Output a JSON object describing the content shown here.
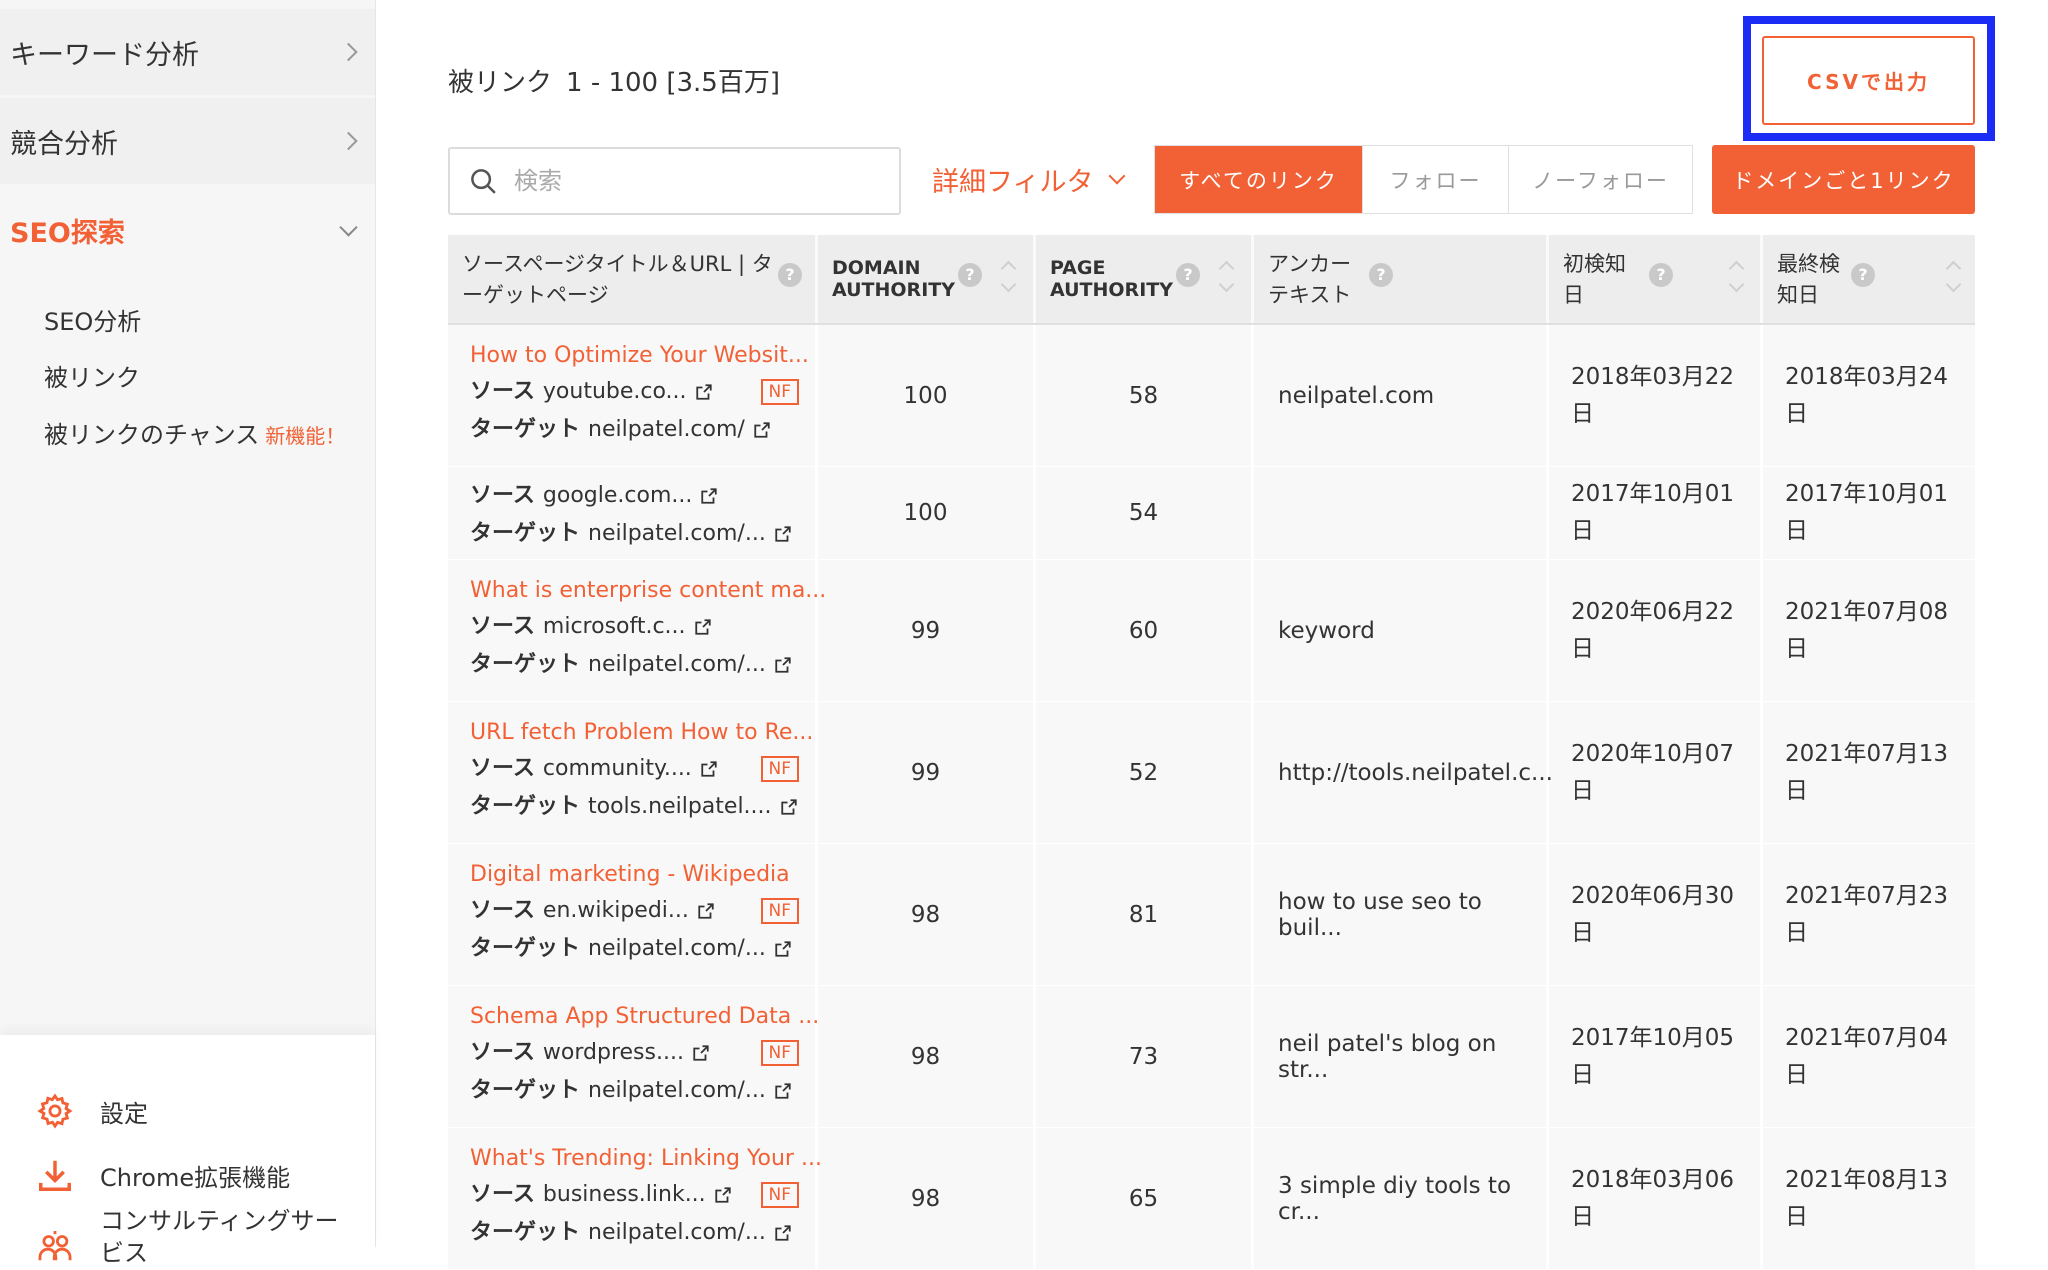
{
  "sidebar": {
    "menu": [
      {
        "label": "キーワード分析"
      },
      {
        "label": "競合分析"
      },
      {
        "label": "SEO探索"
      }
    ],
    "submenu": [
      {
        "label": "SEO分析"
      },
      {
        "label": "被リンク"
      },
      {
        "label": "被リンクのチャンス",
        "badge": "新機能！"
      }
    ],
    "bottom": [
      {
        "label": "設定",
        "icon": "gear-icon"
      },
      {
        "label": "Chrome拡張機能",
        "icon": "download-icon"
      },
      {
        "label": "コンサルティングサービス",
        "icon": "people-icon"
      }
    ]
  },
  "header": {
    "title": "被リンク",
    "range": "1 - 100 [3.5百万]",
    "csv_button": "CSVで出力"
  },
  "toolbar": {
    "search_placeholder": "検索",
    "filter_label": "詳細フィルタ",
    "tabs": [
      "すべてのリンク",
      "フォロー",
      "ノーフォロー"
    ],
    "domain_button": "ドメインごと1リンク"
  },
  "table": {
    "headers": {
      "source": "ソースページタイトル＆URL | ターゲットページ",
      "domain_authority": "DOMAIN AUTHORITY",
      "page_authority": "PAGE AUTHORITY",
      "anchor": "アンカーテキスト",
      "first_seen": "初検知日",
      "last_seen": "最終検知日"
    },
    "source_label": "ソース",
    "target_label": "ターゲット",
    "nf_label": "NF",
    "rows": [
      {
        "title": "How to Optimize Your Websit...",
        "source": "youtube.co...",
        "target": "neilpatel.com/",
        "nf": true,
        "da": "100",
        "pa": "58",
        "anchor": "neilpatel.com",
        "first": "2018年03月22日",
        "last": "2018年03月24日"
      },
      {
        "title": "",
        "source": "google.com...",
        "target": "neilpatel.com/...",
        "nf": false,
        "da": "100",
        "pa": "54",
        "anchor": "",
        "first": "2017年10月01日",
        "last": "2017年10月01日"
      },
      {
        "title": "What is enterprise content ma...",
        "source": "microsoft.c...",
        "target": "neilpatel.com/...",
        "nf": false,
        "da": "99",
        "pa": "60",
        "anchor": "keyword",
        "first": "2020年06月22日",
        "last": "2021年07月08日"
      },
      {
        "title": "URL fetch Problem How to Re...",
        "source": "community....",
        "target": "tools.neilpatel....",
        "nf": true,
        "da": "99",
        "pa": "52",
        "anchor": "http://tools.neilpatel.c...",
        "first": "2020年10月07日",
        "last": "2021年07月13日"
      },
      {
        "title": "Digital marketing - Wikipedia",
        "source": "en.wikipedi...",
        "target": "neilpatel.com/...",
        "nf": true,
        "da": "98",
        "pa": "81",
        "anchor": "how to use seo to buil...",
        "first": "2020年06月30日",
        "last": "2021年07月23日"
      },
      {
        "title": "Schema App Structured Data ...",
        "source": "wordpress....",
        "target": "neilpatel.com/...",
        "nf": true,
        "da": "98",
        "pa": "73",
        "anchor": "neil patel's blog on str...",
        "first": "2017年10月05日",
        "last": "2021年07月04日"
      },
      {
        "title": "What's Trending: Linking Your ...",
        "source": "business.link...",
        "target": "neilpatel.com/...",
        "nf": true,
        "da": "98",
        "pa": "65",
        "anchor": "3 simple diy tools to cr...",
        "first": "2018年03月06日",
        "last": "2021年08月13日"
      }
    ]
  }
}
